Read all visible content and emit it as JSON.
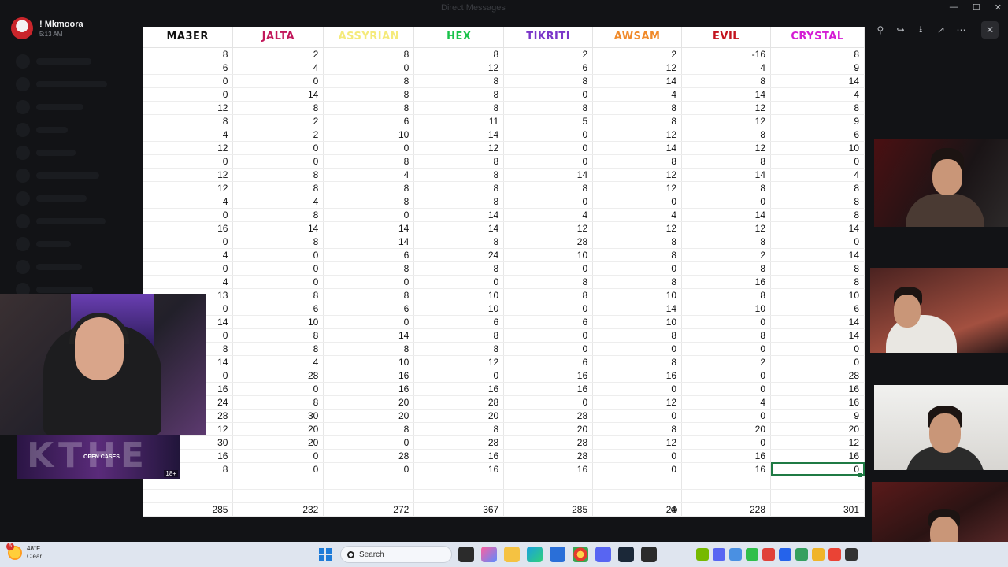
{
  "user": {
    "name": "! Mkmoora",
    "time": "5:13 AM"
  },
  "viewer": {
    "title": "Direct Messages"
  },
  "columns": [
    {
      "label": "MA3ER",
      "color": "#111111"
    },
    {
      "label": "JALTA",
      "color": "#c2185b"
    },
    {
      "label": "ASSYRIAN",
      "color": "#f5ea7a"
    },
    {
      "label": "HEX",
      "color": "#19c24a"
    },
    {
      "label": "TIKRITI",
      "color": "#7a35c9"
    },
    {
      "label": "AWSAM",
      "color": "#f08a2a"
    },
    {
      "label": "EVIL",
      "color": "#c3141e"
    },
    {
      "label": "CRYSTAL",
      "color": "#d41bd4"
    }
  ],
  "rows": [
    [
      "8",
      "2",
      "8",
      "8",
      "2",
      "2",
      "-16",
      "8"
    ],
    [
      "6",
      "4",
      "0",
      "12",
      "6",
      "12",
      "4",
      "9"
    ],
    [
      "0",
      "0",
      "8",
      "8",
      "8",
      "14",
      "8",
      "14"
    ],
    [
      "0",
      "14",
      "8",
      "8",
      "0",
      "4",
      "14",
      "4"
    ],
    [
      "12",
      "8",
      "8",
      "8",
      "8",
      "8",
      "12",
      "8"
    ],
    [
      "8",
      "2",
      "6",
      "11",
      "5",
      "8",
      "12",
      "9"
    ],
    [
      "4",
      "2",
      "10",
      "14",
      "0",
      "12",
      "8",
      "6"
    ],
    [
      "12",
      "0",
      "0",
      "12",
      "0",
      "14",
      "12",
      "10"
    ],
    [
      "0",
      "0",
      "8",
      "8",
      "0",
      "8",
      "8",
      "0"
    ],
    [
      "12",
      "8",
      "4",
      "8",
      "14",
      "12",
      "14",
      "4"
    ],
    [
      "12",
      "8",
      "8",
      "8",
      "8",
      "12",
      "8",
      "8"
    ],
    [
      "4",
      "4",
      "8",
      "8",
      "0",
      "0",
      "0",
      "8"
    ],
    [
      "0",
      "8",
      "0",
      "14",
      "4",
      "4",
      "14",
      "8"
    ],
    [
      "16",
      "14",
      "14",
      "14",
      "12",
      "12",
      "12",
      "14"
    ],
    [
      "0",
      "8",
      "14",
      "8",
      "28",
      "8",
      "8",
      "0"
    ],
    [
      "4",
      "0",
      "6",
      "24",
      "10",
      "8",
      "2",
      "14"
    ],
    [
      "0",
      "0",
      "8",
      "8",
      "0",
      "0",
      "8",
      "8"
    ],
    [
      "4",
      "0",
      "0",
      "0",
      "8",
      "8",
      "16",
      "8"
    ],
    [
      "13",
      "8",
      "8",
      "10",
      "8",
      "10",
      "8",
      "10"
    ],
    [
      "0",
      "6",
      "6",
      "10",
      "0",
      "14",
      "10",
      "6"
    ],
    [
      "14",
      "10",
      "0",
      "6",
      "6",
      "10",
      "0",
      "14"
    ],
    [
      "0",
      "8",
      "14",
      "8",
      "0",
      "8",
      "8",
      "14"
    ],
    [
      "8",
      "8",
      "8",
      "8",
      "0",
      "0",
      "0",
      "0"
    ],
    [
      "14",
      "4",
      "10",
      "12",
      "6",
      "8",
      "2",
      "0"
    ],
    [
      "0",
      "28",
      "16",
      "0",
      "16",
      "16",
      "0",
      "28"
    ],
    [
      "16",
      "0",
      "16",
      "16",
      "16",
      "0",
      "0",
      "16"
    ],
    [
      "24",
      "8",
      "20",
      "28",
      "0",
      "12",
      "4",
      "16"
    ],
    [
      "28",
      "30",
      "20",
      "20",
      "28",
      "0",
      "0",
      "9"
    ],
    [
      "12",
      "20",
      "8",
      "8",
      "20",
      "8",
      "20",
      "20"
    ],
    [
      "30",
      "20",
      "0",
      "28",
      "28",
      "12",
      "0",
      "12"
    ],
    [
      "16",
      "0",
      "28",
      "16",
      "28",
      "0",
      "16",
      "16"
    ],
    [
      "8",
      "0",
      "0",
      "16",
      "16",
      "0",
      "16",
      "0"
    ]
  ],
  "totals": [
    "285",
    "232",
    "272",
    "367",
    "285",
    "24",
    "228",
    "301"
  ],
  "promo": {
    "big": "KTHE",
    "label": "OPEN CASES",
    "age": "18+"
  },
  "taskbar": {
    "temp": "48°F",
    "condition": "Clear",
    "search": "Search",
    "notif": "6"
  }
}
